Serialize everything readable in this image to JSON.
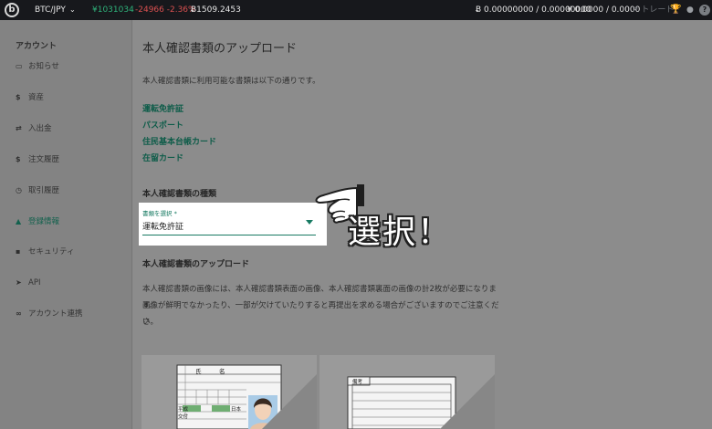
{
  "topbar": {
    "pair": "BTC/JPY",
    "pair_chevron": "chevron-down-icon",
    "price": "¥1031034",
    "change": "-24966 -2.36%",
    "btc_price": "Ƀ1509.2453",
    "btc_balance": "Ƀ 0.00000000 / 0.00000000",
    "jpy_balance": "¥ 0.0000 / 0.0000",
    "trade_label": "トレード",
    "icons": [
      "logo-icon",
      "trend-icon",
      "trophy-icon",
      "user-icon",
      "help-icon"
    ],
    "colors": {
      "up": "#2fb37b",
      "down": "#d95050",
      "bar": "#17181c"
    }
  },
  "sidebar": {
    "title": "アカウント",
    "items": [
      {
        "label": "お知らせ",
        "icon": "inbox-icon",
        "glyph": "▭",
        "active": false
      },
      {
        "label": "資産",
        "icon": "dollar-icon",
        "glyph": "$",
        "active": false
      },
      {
        "label": "入出金",
        "icon": "transfer-icon",
        "glyph": "⇄",
        "active": false
      },
      {
        "label": "注文履歴",
        "icon": "dollar-icon",
        "glyph": "$",
        "active": false
      },
      {
        "label": "取引履歴",
        "icon": "clock-icon",
        "glyph": "◷",
        "active": false
      },
      {
        "label": "登録情報",
        "icon": "user-icon",
        "glyph": "▲",
        "active": true
      },
      {
        "label": "セキュリティ",
        "icon": "lock-icon",
        "glyph": "▪",
        "active": false
      },
      {
        "label": "API",
        "icon": "send-icon",
        "glyph": "➤",
        "active": false
      },
      {
        "label": "アカウント連携",
        "icon": "link-icon",
        "glyph": "∞",
        "active": false
      }
    ],
    "active_color": "#12614d"
  },
  "main": {
    "title": "本人確認書類のアップロード",
    "intro": "本人確認書類に利用可能な書類は以下の通りです。",
    "documents": [
      "運転免許証",
      "パスポート",
      "住民基本台帳カード",
      "在留カード"
    ],
    "type_section": "本人確認書類の種類",
    "select": {
      "caption": "書類を選択 *",
      "value": "運転免許証"
    },
    "upload_section": "本人確認書類のアップロード",
    "description_lines": [
      "本人確認書類の画像には、本人確認書類表面の画像、本人確認書類裏面の画像の計2枚が必要になります。",
      "画像が鮮明でなかったり、一部が欠けていたりすると再提出を求める場合がございますのでご注意くださ",
      "い。"
    ],
    "link_color": "#0e5c49"
  },
  "annotation": {
    "callout": "選択！",
    "pointer_icon": "pointing-hand-icon"
  },
  "samples": {
    "front_labels": [
      "氏",
      "名",
      "平成",
      "日本",
      "交付"
    ],
    "back_label": "備考"
  }
}
